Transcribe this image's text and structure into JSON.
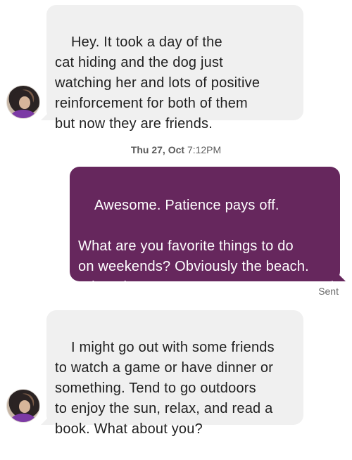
{
  "conversation": {
    "messages": [
      {
        "direction": "incoming",
        "text": "Hey. It took a day of the\ncat hiding and the dog just\nwatching her and lots of positive\nreinforcement for both of them\nbut now they are friends."
      },
      {
        "direction": "outgoing",
        "text": "Awesome. Patience pays off.\n\nWhat are you favorite things to do\non weekends? Obviously the beach.\nWhat else?"
      },
      {
        "direction": "incoming",
        "text": "I might go out with some friends\nto watch a game or have dinner or\nsomething. Tend to go outdoors\nto enjoy the sun, relax, and read a\nbook. What about you?"
      }
    ],
    "timestamp": {
      "date": "Thu 27, Oct",
      "time": "7:12PM"
    },
    "sent_status": "Sent"
  },
  "colors": {
    "incoming_bubble": "#f0f0f0",
    "outgoing_bubble": "#66275d",
    "status_text": "#6a6a6a"
  }
}
